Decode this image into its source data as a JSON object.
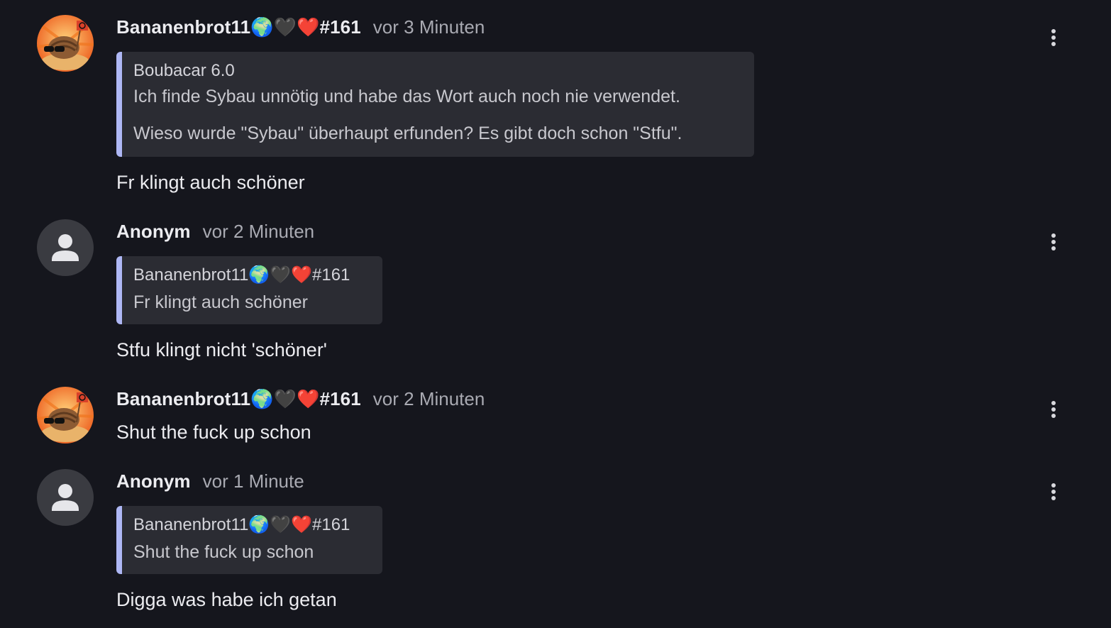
{
  "comments": [
    {
      "author": "Bananenbrot11🌍🖤❤️#161",
      "time": "vor 3 Minuten",
      "avatar": "user-avatar",
      "quote": {
        "author": "Boubacar 6.0",
        "lines": [
          "Ich finde Sybau unnötig und habe das Wort auch noch nie verwendet.",
          "Wieso wurde \"Sybau\" überhaupt erfunden? Es gibt doch schon \"Stfu\"."
        ]
      },
      "text": "Fr klingt auch schöner"
    },
    {
      "author": "Anonym",
      "time": "vor 2 Minuten",
      "avatar": "person-icon",
      "quote": {
        "author": "Bananenbrot11🌍🖤❤️#161",
        "lines": [
          "Fr klingt auch schöner"
        ]
      },
      "text": "Stfu klingt nicht 'schöner'"
    },
    {
      "author": "Bananenbrot11🌍🖤❤️#161",
      "time": "vor 2 Minuten",
      "avatar": "user-avatar",
      "text": "Shut the fuck up schon"
    },
    {
      "author": "Anonym",
      "time": "vor 1 Minute",
      "avatar": "person-icon",
      "quote": {
        "author": "Bananenbrot11🌍🖤❤️#161",
        "lines": [
          "Shut the fuck up schon"
        ]
      },
      "text": "Digga was habe ich getan"
    }
  ],
  "icons": {
    "menu": "more-vertical-icon"
  },
  "colors": {
    "background": "#15161d",
    "quote_background": "#2b2c33",
    "quote_accent": "#aeb7f4",
    "anon_avatar": "#3a3b41"
  }
}
